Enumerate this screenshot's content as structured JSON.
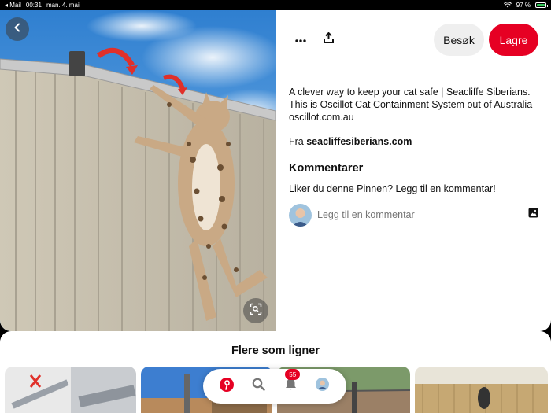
{
  "status_bar": {
    "back_app": "◂ Mail",
    "time": "00:31",
    "date": "man. 4. mai",
    "battery": "97 %",
    "battery_level": 0.97
  },
  "pin": {
    "image_alt": "Cat climbing a fence with a rotating roller on top",
    "description": "A clever way to keep your cat safe | Seacliffe Siberians. This is Oscillot Cat Containment System out of Australia oscillot.com.au",
    "source_prefix": "Fra ",
    "source_domain": "seacliffesiberians.com"
  },
  "actions": {
    "visit_label": "Besøk",
    "save_label": "Lagre"
  },
  "comments": {
    "title": "Kommentarer",
    "prompt": "Liker du denne Pinnen? Legg til en kommentar!",
    "input_placeholder": "Legg til en kommentar"
  },
  "more_like_this": {
    "title": "Flere som ligner"
  },
  "bottom_nav": {
    "notification_count": "55"
  },
  "colors": {
    "brand_red": "#e60023",
    "visit_bg": "#efefef"
  }
}
